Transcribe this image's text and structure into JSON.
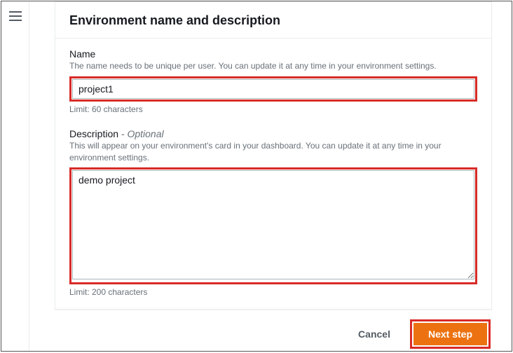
{
  "header": {
    "title": "Environment name and description"
  },
  "name_field": {
    "label": "Name",
    "helper": "The name needs to be unique per user. You can update it at any time in your environment settings.",
    "value": "project1",
    "limit": "Limit: 60 characters"
  },
  "description_field": {
    "label": "Description",
    "optional": " - Optional",
    "helper": "This will appear on your environment's card in your dashboard. You can update it at any time in your environment settings.",
    "value": "demo project",
    "limit": "Limit: 200 characters"
  },
  "footer": {
    "cancel_label": "Cancel",
    "next_label": "Next step"
  }
}
